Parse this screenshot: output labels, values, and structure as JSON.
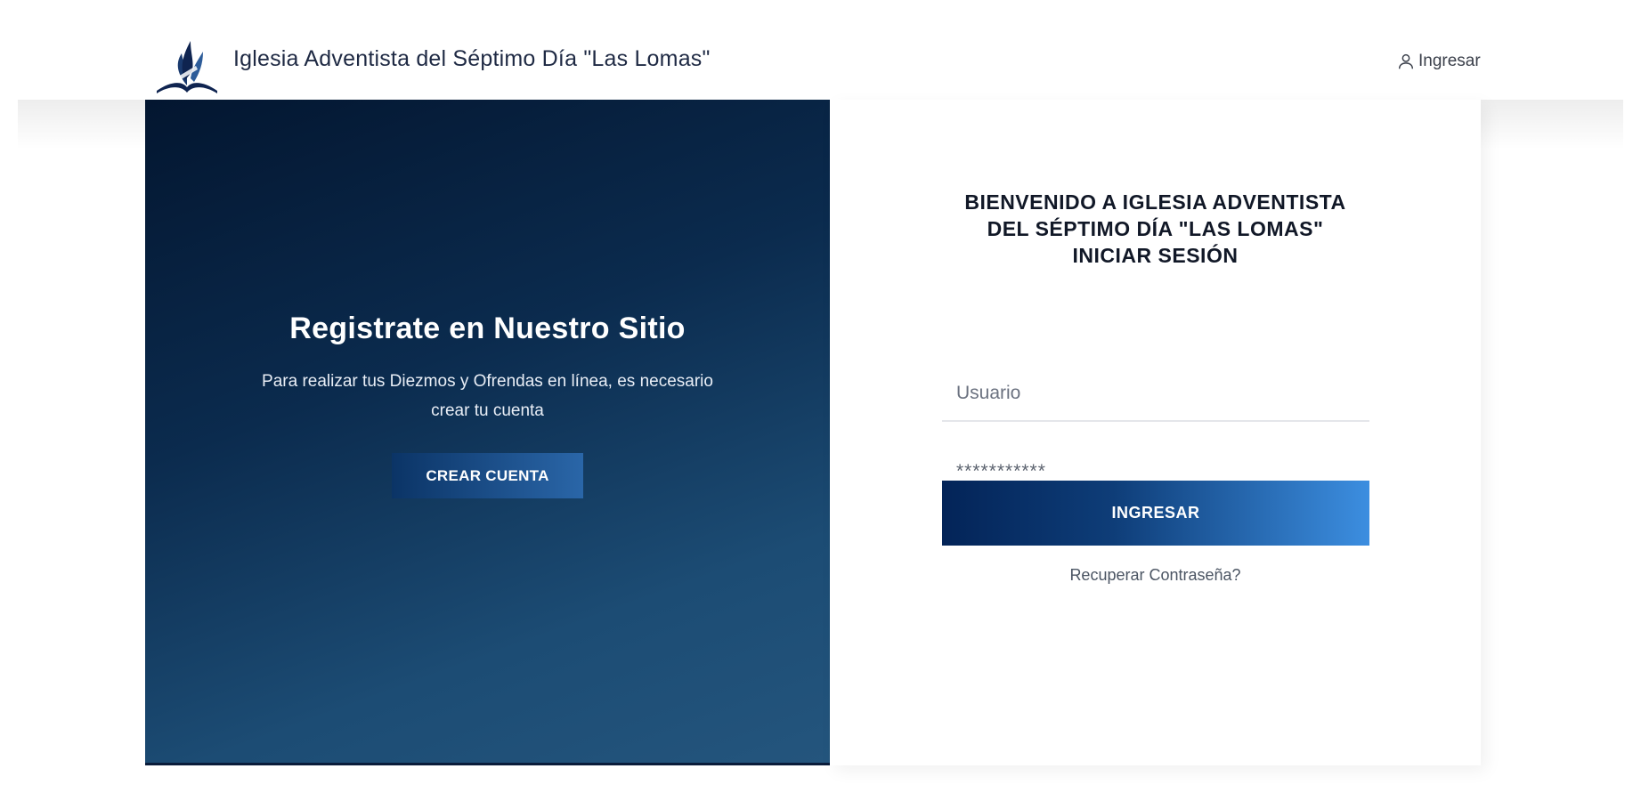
{
  "header": {
    "logo_icon": "church-flame-bible-logo-icon",
    "title": "Iglesia Adventista del Séptimo Día \"Las Lomas\"",
    "login_icon": "user-icon",
    "login_label": "Ingresar"
  },
  "promo": {
    "title": "Registrate en Nuestro Sitio",
    "text": "Para realizar tus Diezmos y Ofrendas en línea, es necesario crear tu cuenta",
    "button_label": "CREAR CUENTA"
  },
  "login": {
    "welcome_lines": [
      "BIENVENIDO A IGLESIA ADVENTISTA",
      "DEL SÉPTIMO DÍA \"LAS LOMAS\"",
      "INICIAR SESIÓN"
    ],
    "username_placeholder": "Usuario",
    "password_value": "***********",
    "submit_label": "INGRESAR",
    "recover_label": "Recuperar Contraseña?"
  },
  "colors": {
    "brand_navy": "#0b2b4e",
    "button_gradient_start": "#032458",
    "button_gradient_end": "#3c8ee0"
  }
}
